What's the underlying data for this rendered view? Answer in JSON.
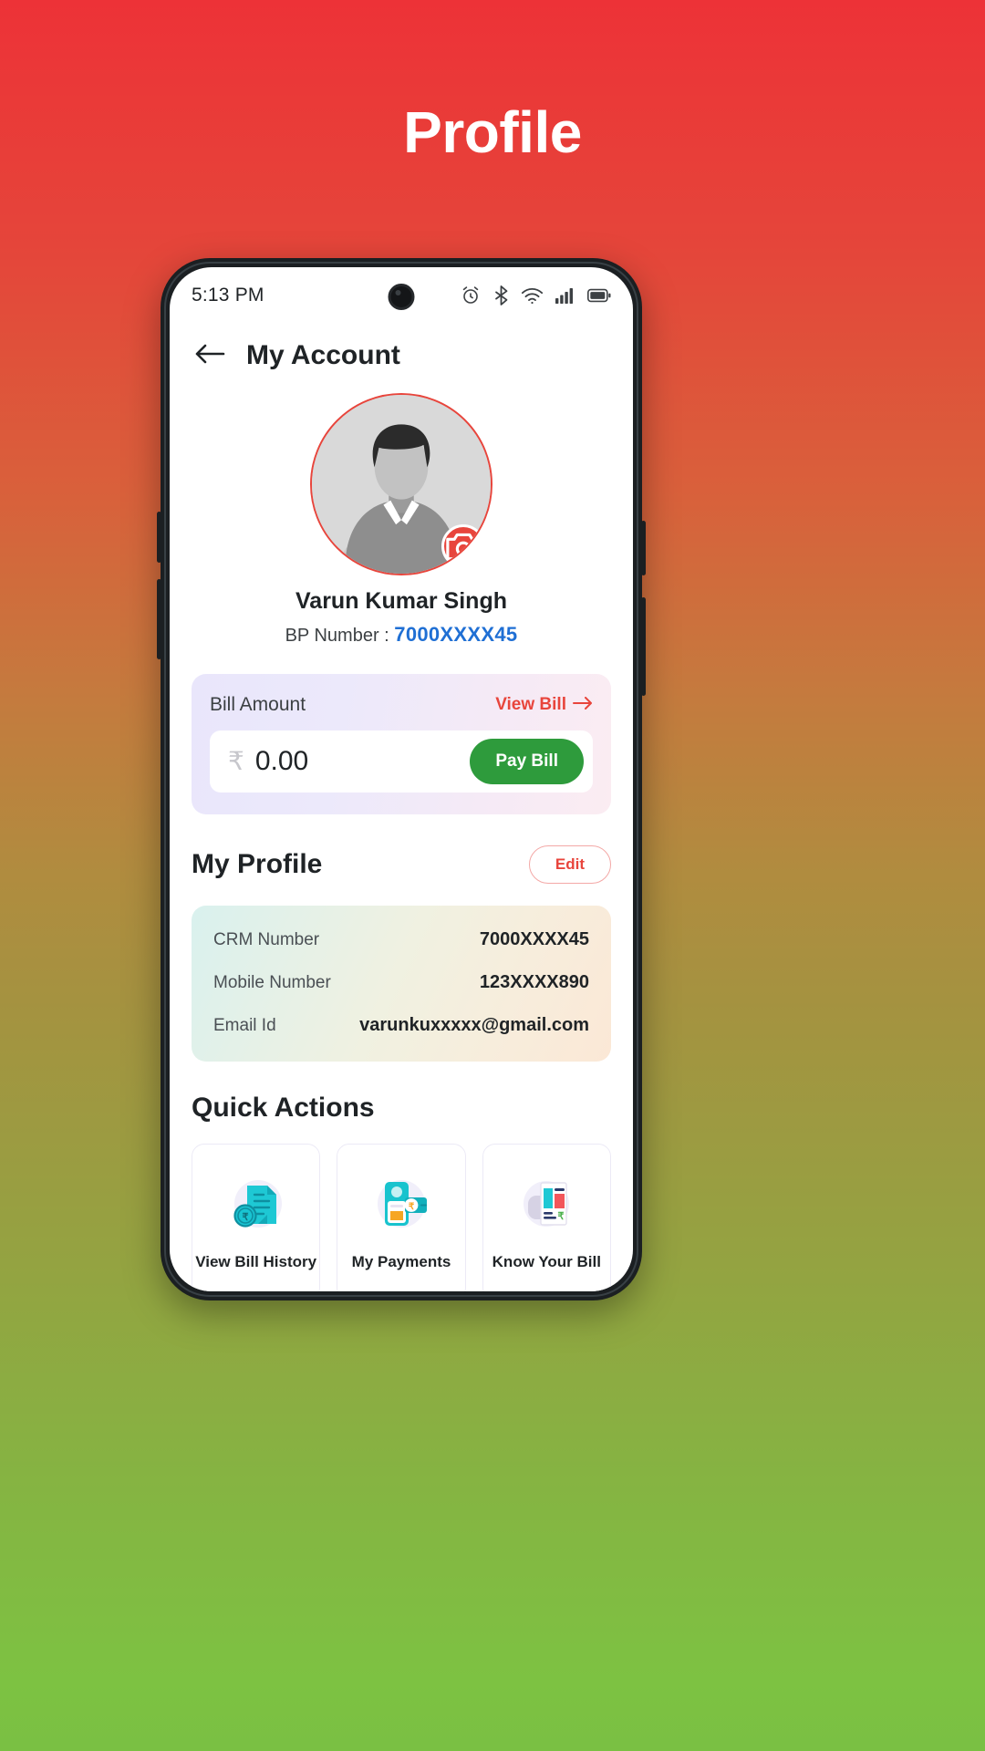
{
  "page": {
    "title": "Profile"
  },
  "theme": {
    "gradient_top": "#ED3237",
    "gradient_bottom": "#7DC242",
    "accent_red": "#E8453C",
    "pay_green": "#2E9B3C",
    "bp_blue": "#1F6FD4"
  },
  "status_bar": {
    "time": "5:13 PM",
    "icons": [
      "alarm-icon",
      "bluetooth-icon",
      "wifi-icon",
      "cellular-signal-icon",
      "battery-icon"
    ]
  },
  "app_bar": {
    "back_icon": "arrow-left-icon",
    "title": "My Account"
  },
  "profile": {
    "avatar_icon": "user-avatar-icon",
    "camera_badge_icon": "camera-icon",
    "name": "Varun Kumar Singh",
    "bp_label": "BP Number :",
    "bp_value": "7000XXXX45"
  },
  "bill_card": {
    "label": "Bill Amount",
    "view_bill_label": "View Bill",
    "view_bill_arrow": "arrow-right-icon",
    "currency_symbol": "₹",
    "amount": "0.00",
    "pay_button": "Pay Bill"
  },
  "my_profile": {
    "title": "My Profile",
    "edit_button": "Edit",
    "rows": [
      {
        "key": "CRM Number",
        "value": "7000XXXX45"
      },
      {
        "key": "Mobile Number",
        "value": "123XXXX890"
      },
      {
        "key": "Email Id",
        "value": "varunkuxxxxx@gmail.com"
      }
    ]
  },
  "quick_actions": {
    "title": "Quick Actions",
    "tiles": [
      {
        "label": "View Bill History",
        "icon": "bill-document-rupee-icon"
      },
      {
        "label": "My Payments",
        "icon": "phone-payment-card-icon"
      },
      {
        "label": "Know Your Bill",
        "icon": "bill-breakdown-icon"
      },
      {
        "label": "",
        "icon": "refund-refresh-coin-icon"
      },
      {
        "label": "",
        "icon": "document-file-icon"
      },
      {
        "label": "",
        "icon": "red-circle-icon"
      }
    ]
  }
}
